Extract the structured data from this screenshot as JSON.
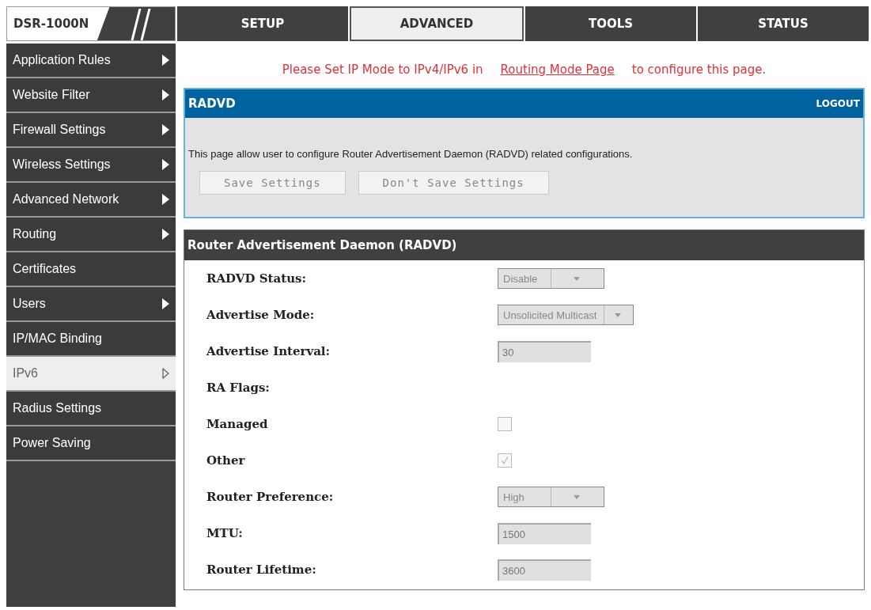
{
  "logo": {
    "text": "DSR-1000N"
  },
  "tabs": [
    {
      "label": "SETUP",
      "selected": false
    },
    {
      "label": "ADVANCED",
      "selected": true
    },
    {
      "label": "TOOLS",
      "selected": false
    },
    {
      "label": "STATUS",
      "selected": false
    }
  ],
  "sidebar": {
    "items": [
      {
        "label": "Application Rules",
        "selected": false,
        "has_submenu": true
      },
      {
        "label": "Website Filter",
        "selected": false,
        "has_submenu": true
      },
      {
        "label": "Firewall Settings",
        "selected": false,
        "has_submenu": true
      },
      {
        "label": "Wireless Settings",
        "selected": false,
        "has_submenu": true
      },
      {
        "label": "Advanced Network",
        "selected": false,
        "has_submenu": true
      },
      {
        "label": "Routing",
        "selected": false,
        "has_submenu": true
      },
      {
        "label": "Certificates",
        "selected": false,
        "has_submenu": false
      },
      {
        "label": "Users",
        "selected": false,
        "has_submenu": true
      },
      {
        "label": "IP/MAC Binding",
        "selected": false,
        "has_submenu": false
      },
      {
        "label": "IPv6",
        "selected": true,
        "has_submenu": true
      },
      {
        "label": "Radius Settings",
        "selected": false,
        "has_submenu": false
      },
      {
        "label": "Power Saving",
        "selected": false,
        "has_submenu": false
      }
    ]
  },
  "notice": {
    "before": "Please Set IP Mode to IPv4/IPv6 in",
    "link": "Routing Mode Page",
    "after": "to configure this page."
  },
  "info_panel": {
    "title": "RADVD",
    "logout": "LOGOUT",
    "description": "This page allow user to configure Router Advertisement Daemon (RADVD) related configurations.",
    "buttons": [
      "Save Settings",
      "Don't Save Settings"
    ]
  },
  "form_panel": {
    "title": "Router Advertisement Daemon (RADVD)",
    "rows": [
      {
        "kind": "select",
        "label": "RADVD Status:",
        "value": "Disable"
      },
      {
        "kind": "select",
        "label": "Advertise Mode:",
        "value": "Unsolicited Multicast"
      },
      {
        "kind": "text",
        "label": "Advertise Interval:",
        "value": "30"
      },
      {
        "kind": "heading",
        "label": "RA Flags:"
      },
      {
        "kind": "checkbox",
        "label": "Managed",
        "checked": false
      },
      {
        "kind": "checkbox",
        "label": "Other",
        "checked": true
      },
      {
        "kind": "select",
        "label": "Router Preference:",
        "value": "High"
      },
      {
        "kind": "text",
        "label": "MTU:",
        "value": "1500"
      },
      {
        "kind": "text",
        "label": "Router Lifetime:",
        "value": "3600"
      }
    ]
  }
}
